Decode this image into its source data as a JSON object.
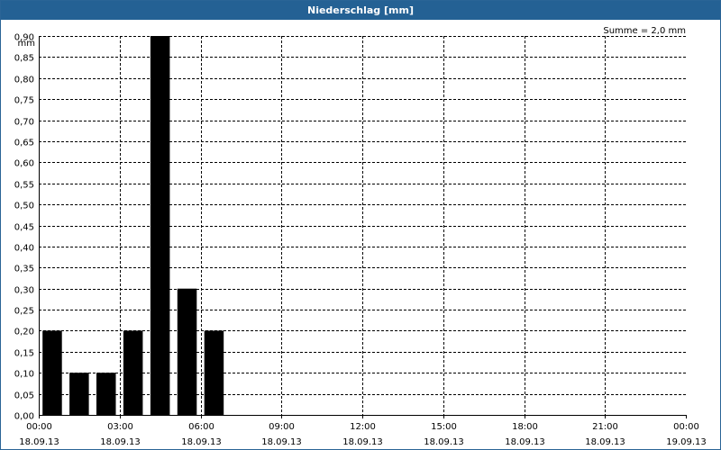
{
  "window": {
    "title": "Niederschlag [mm]"
  },
  "colors": {
    "titlebar": "#246194",
    "bar": "#000000",
    "grid": "#000000"
  },
  "chart_data": {
    "type": "bar",
    "title": "Niederschlag [mm]",
    "ylabel": "mm",
    "xlabel": "",
    "sum_label": "Summe = 2,0 mm",
    "ylim": [
      0,
      0.9
    ],
    "y_ticks": [
      "0,00",
      "0,05",
      "0,10",
      "0,15",
      "0,20",
      "0,25",
      "0,30",
      "0,35",
      "0,40",
      "0,45",
      "0,50",
      "0,55",
      "0,60",
      "0,65",
      "0,70",
      "0,75",
      "0,80",
      "0,85",
      "0,90"
    ],
    "x_ticks": [
      {
        "time": "00:00",
        "date": "18.09.13"
      },
      {
        "time": "03:00",
        "date": "18.09.13"
      },
      {
        "time": "06:00",
        "date": "18.09.13"
      },
      {
        "time": "09:00",
        "date": "18.09.13"
      },
      {
        "time": "12:00",
        "date": "18.09.13"
      },
      {
        "time": "15:00",
        "date": "18.09.13"
      },
      {
        "time": "18:00",
        "date": "18.09.13"
      },
      {
        "time": "21:00",
        "date": "18.09.13"
      },
      {
        "time": "00:00",
        "date": "19.09.13"
      }
    ],
    "bar_interval_hours": 1,
    "categories": [
      "00:00",
      "01:00",
      "02:00",
      "03:00",
      "04:00",
      "05:00",
      "06:00"
    ],
    "values": [
      0.2,
      0.1,
      0.1,
      0.2,
      0.9,
      0.3,
      0.2
    ],
    "grid": true,
    "legend": "none"
  }
}
